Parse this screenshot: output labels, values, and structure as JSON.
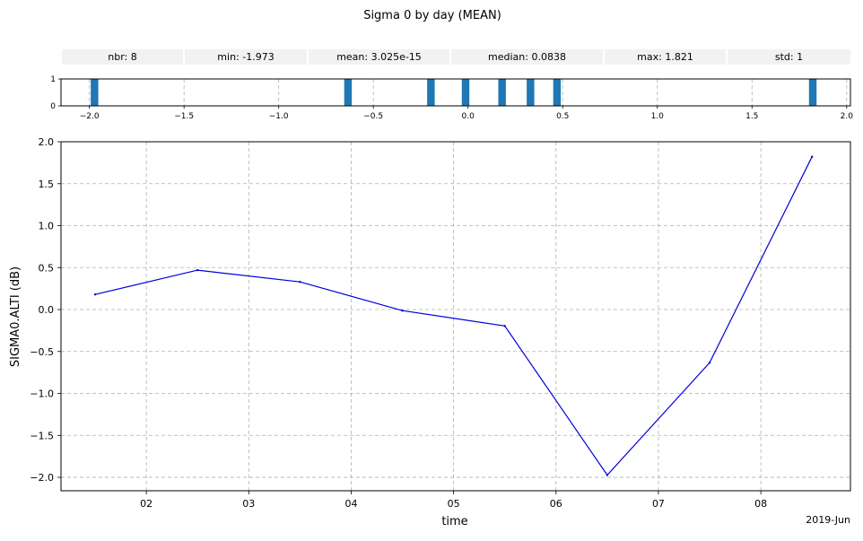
{
  "title": "Sigma 0 by day (MEAN)",
  "stats": [
    {
      "label": "nbr:",
      "value": "8"
    },
    {
      "label": "min:",
      "value": "-1.973"
    },
    {
      "label": "mean:",
      "value": "3.025e-15"
    },
    {
      "label": "median:",
      "value": "0.0838"
    },
    {
      "label": "max:",
      "value": "1.821"
    },
    {
      "label": "std:",
      "value": "1"
    }
  ],
  "colors": {
    "line": "#0000dd",
    "bar": "#1f77b4",
    "grid": "#b0b0b0",
    "stats_bg": "#f2f2f2"
  },
  "chart_data": [
    {
      "type": "bar",
      "description_role": "histogram",
      "x_ticks": [
        "−2.0",
        "−1.5",
        "−1.0",
        "−0.5",
        "0.0",
        "0.5",
        "1.0",
        "1.5",
        "2.0"
      ],
      "x_tick_values": [
        -2.0,
        -1.5,
        -1.0,
        -0.5,
        0.0,
        0.5,
        1.0,
        1.5,
        2.0
      ],
      "y_ticks": [
        "0",
        "1"
      ],
      "xlim": [
        -2.15,
        2.02
      ],
      "ylim": [
        0,
        1
      ],
      "bar_centers": [
        -1.973,
        -0.634,
        -0.196,
        -0.013,
        0.18,
        0.33,
        0.47,
        1.821
      ],
      "values": [
        1,
        1,
        1,
        1,
        1,
        1,
        1,
        1
      ],
      "bar_width": 0.04,
      "grid": true
    },
    {
      "type": "line",
      "xlabel": "time",
      "ylabel": "SIGMA0.ALTI (dB)",
      "x_ticks": [
        "02",
        "03",
        "04",
        "05",
        "06",
        "07",
        "08"
      ],
      "x_tick_values": [
        "2019-06-02",
        "2019-06-03",
        "2019-06-04",
        "2019-06-05",
        "2019-06-06",
        "2019-06-07",
        "2019-06-08"
      ],
      "x_offset_label": "2019-Jun",
      "y_ticks": [
        "2.0",
        "1.5",
        "1.0",
        "0.5",
        "0.0",
        "−0.5",
        "−1.0",
        "−1.5",
        "−2.0"
      ],
      "y_tick_values": [
        2.0,
        1.5,
        1.0,
        0.5,
        0.0,
        -0.5,
        -1.0,
        -1.5,
        -2.0
      ],
      "xlim": [
        "2019-06-01 04:00",
        "2019-06-08 21:00"
      ],
      "ylim": [
        -2.16,
        2.0
      ],
      "x": [
        "2019-06-01 12:00",
        "2019-06-02 12:00",
        "2019-06-03 12:00",
        "2019-06-04 12:00",
        "2019-06-05 12:00",
        "2019-06-06 12:00",
        "2019-06-07 12:00",
        "2019-06-08 12:00"
      ],
      "values": [
        0.18,
        0.47,
        0.33,
        -0.013,
        -0.196,
        -1.973,
        -0.634,
        1.821
      ],
      "grid": true
    }
  ]
}
